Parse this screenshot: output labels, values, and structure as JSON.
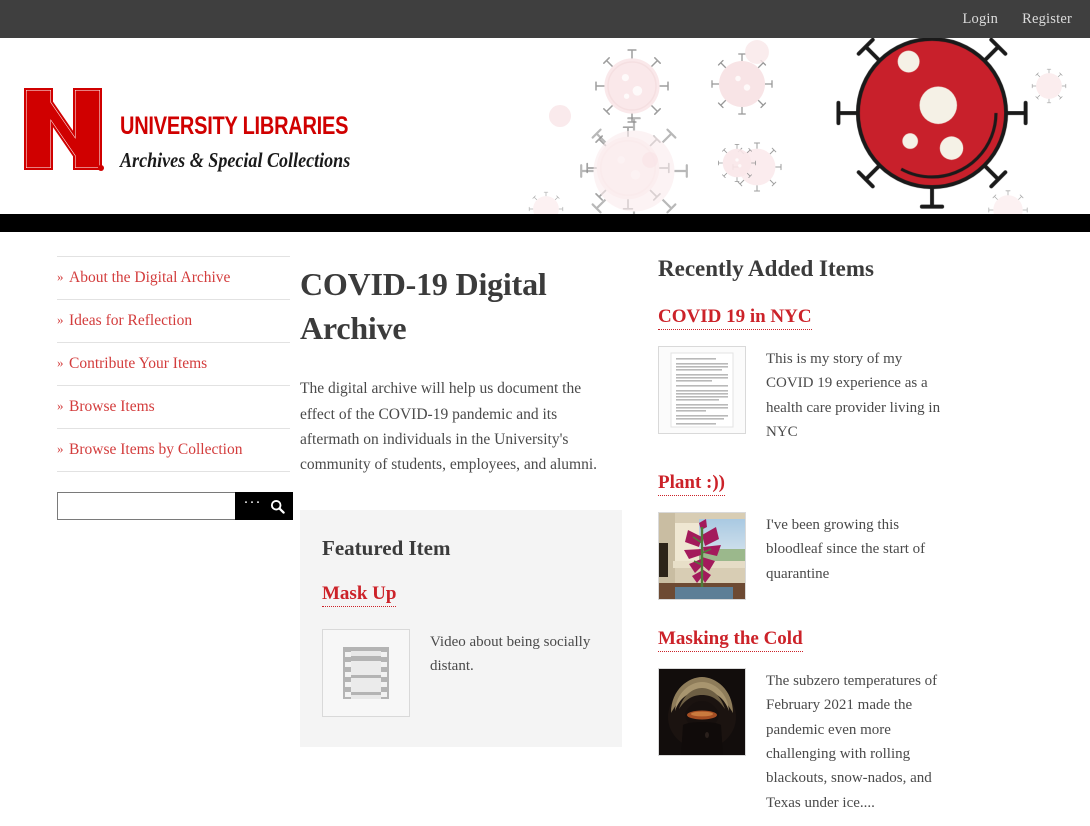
{
  "topbar": {
    "login_label": "Login",
    "register_label": "Register"
  },
  "banner": {
    "brand_title": "UNIVERSITY LIBRARIES",
    "brand_subtitle": "Archives & Special Collections",
    "logo_letter": "N",
    "brand_red": "#d00000",
    "virus_red": "#cc2229",
    "virus_faded": "#f4d5d7"
  },
  "sidebar": {
    "chevron": "»",
    "items": [
      {
        "label": "About the Digital Archive"
      },
      {
        "label": "Ideas for Reflection"
      },
      {
        "label": "Contribute Your Items"
      },
      {
        "label": "Browse Items"
      },
      {
        "label": "Browse Items by Collection"
      }
    ],
    "search": {
      "value": "",
      "placeholder": "",
      "advanced_label": "···",
      "submit_icon": "search-icon"
    }
  },
  "main": {
    "title": "COVID-19 Digital Archive",
    "description": "The digital archive will help us document the effect of the COVID-19 pandemic and its aftermath on individuals in the University's community of students, employees, and alumni.",
    "featured": {
      "heading": "Featured Item",
      "item_title": "Mask Up",
      "item_caption": "Video about being socially distant.",
      "thumbnail_icon": "film-strip-icon"
    }
  },
  "rail": {
    "heading": "Recently Added Items",
    "items": [
      {
        "title": "COVID 19 in NYC",
        "description": "This is my story of my COVID 19 experience as a health care provider living in NYC",
        "thumbnail": "document-page-thumbnail"
      },
      {
        "title": "Plant :))",
        "description": "I've been growing this bloodleaf since the start of quarantine",
        "thumbnail": "plant-photo-thumbnail"
      },
      {
        "title": "Masking the Cold",
        "description": "The subzero temperatures of February 2021 made the pandemic even more challenging with rolling blackouts, snow-nados, and Texas under ice....",
        "thumbnail": "parka-photo-thumbnail"
      }
    ]
  }
}
